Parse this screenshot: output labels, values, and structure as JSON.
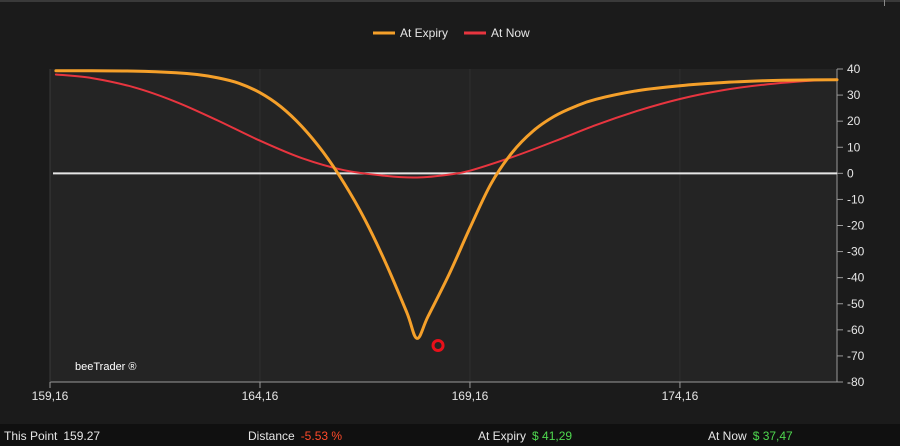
{
  "chart_data": {
    "type": "line",
    "watermark": "beeTrader ®",
    "xlim": [
      159.16,
      177.9
    ],
    "ylim": [
      -80,
      40
    ],
    "x_ticks": [
      159.16,
      164.16,
      169.16,
      174.16
    ],
    "x_tick_labels": [
      "159,16",
      "164,16",
      "169,16",
      "174,16"
    ],
    "y_ticks": [
      40,
      30,
      20,
      10,
      0,
      -10,
      -20,
      -30,
      -40,
      -50,
      -60,
      -70,
      -80
    ],
    "y_tick_labels": [
      "40",
      "30",
      "20",
      "10",
      "0",
      "-10",
      "-20",
      "-30",
      "-40",
      "-50",
      "-60",
      "-70",
      "-80"
    ],
    "zero_line": 0,
    "marker": {
      "x": 168.4,
      "y": -66,
      "color": "#e8101a"
    },
    "series": [
      {
        "name": "At Expiry",
        "color": "#f5a02a",
        "points": [
          [
            159.3,
            39.3
          ],
          [
            160.16,
            39.3
          ],
          [
            161.16,
            39.2
          ],
          [
            162.16,
            38.6
          ],
          [
            162.66,
            37.9
          ],
          [
            163.16,
            36.6
          ],
          [
            163.66,
            34.5
          ],
          [
            164.16,
            30.9
          ],
          [
            164.66,
            25.5
          ],
          [
            165.16,
            17.9
          ],
          [
            165.66,
            8.2
          ],
          [
            166.16,
            -3.7
          ],
          [
            166.66,
            -17.8
          ],
          [
            167.16,
            -34.6
          ],
          [
            167.66,
            -53.5
          ],
          [
            167.9,
            -63.3
          ],
          [
            168.16,
            -54.9
          ],
          [
            168.66,
            -38.8
          ],
          [
            169.16,
            -20.9
          ],
          [
            169.66,
            -4.0
          ],
          [
            170.16,
            7.9
          ],
          [
            170.66,
            16.2
          ],
          [
            171.16,
            21.8
          ],
          [
            171.66,
            25.6
          ],
          [
            172.16,
            28.4
          ],
          [
            173.16,
            31.7
          ],
          [
            174.16,
            33.6
          ],
          [
            175.16,
            34.8
          ],
          [
            176.16,
            35.5
          ],
          [
            177.16,
            35.8
          ],
          [
            177.9,
            35.9
          ]
        ]
      },
      {
        "name": "At Now",
        "color": "#e8353f",
        "points": [
          [
            159.3,
            37.9
          ],
          [
            160.16,
            36.5
          ],
          [
            161.16,
            33.0
          ],
          [
            162.16,
            27.4
          ],
          [
            163.16,
            20.2
          ],
          [
            164.16,
            12.5
          ],
          [
            165.16,
            5.8
          ],
          [
            166.16,
            1.2
          ],
          [
            167.16,
            -1.0
          ],
          [
            167.9,
            -1.6
          ],
          [
            168.66,
            -0.5
          ],
          [
            169.16,
            1.0
          ],
          [
            170.16,
            6.2
          ],
          [
            171.16,
            12.2
          ],
          [
            172.16,
            18.5
          ],
          [
            173.16,
            24.0
          ],
          [
            174.16,
            28.5
          ],
          [
            175.16,
            31.8
          ],
          [
            176.16,
            34.0
          ],
          [
            177.16,
            35.4
          ],
          [
            177.9,
            36.0
          ]
        ]
      }
    ],
    "legend": {
      "position": "top-center"
    },
    "colors": {
      "background": "#1b1b1b",
      "plot_background": "#242424",
      "grid": "#303030",
      "axis": "#9a9a9a",
      "zero_line": "#e6e6e6",
      "text": "#e6e6e6",
      "positive": "#4fd84f",
      "negative": "#ff4a2a"
    }
  },
  "footer": {
    "this_point_label": "This Point",
    "this_point_value": "159.27",
    "distance_label": "Distance",
    "distance_value": "-5.53 %",
    "at_expiry_label": "At Expiry",
    "at_expiry_value": "$ 41,29",
    "at_now_label": "At Now",
    "at_now_value": "$ 37,47"
  }
}
